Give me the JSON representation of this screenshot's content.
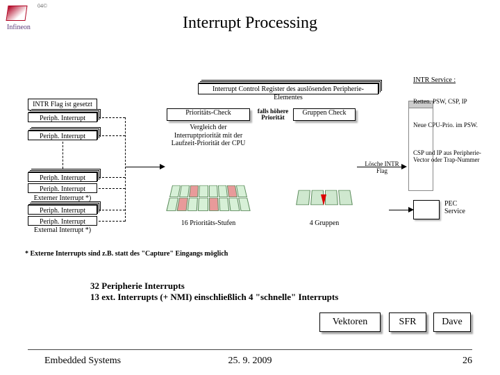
{
  "slide_id": "04©",
  "brand_mark": "Infineon",
  "title": "Interrupt Processing",
  "intr_register": "Interrupt Control Register des auslösenden Peripherie-Elementes",
  "flag_tag": "INTR Flag ist gesetzt",
  "periph": {
    "label": "Periph. Interrupt",
    "ext_label": "Externer Interrupt *)",
    "ext_label2": "External Interrupt *)"
  },
  "priority_check": "Prioritäts-Check",
  "vergleich": "Vergleich der Interruptpriorität mit der Laufzeit-Priorität der CPU",
  "falls": "falls höhere Priorität",
  "gruppen_check": "Gruppen Check",
  "caption_prio": "16 Prioritäts-Stufen",
  "caption_grup": "4 Gruppen",
  "loesche": "Lösche INTR Flag",
  "intr_service_title": "INTR Service :",
  "right_items": [
    "Retten. PSW, CSP, IP",
    "Neue CPU-Prio. im PSW.",
    "CSP und IP aus Peripherie-Vector oder Trap-Nummer"
  ],
  "pec": "PEC Service",
  "footnote": "* Externe Interrupts sind z.B. statt des \"Capture\" Eingangs möglich",
  "summary": [
    "32 Peripherie Interrupts",
    "13 ext. Interrupts (+ NMI) einschließlich 4 \"schnelle\" Interrupts"
  ],
  "buttons": {
    "vectors": "Vektoren",
    "sfr": "SFR",
    "dave": "Dave"
  },
  "footer": {
    "left": "Embedded Systems",
    "center": "25. 9. 2009",
    "right": "26"
  }
}
